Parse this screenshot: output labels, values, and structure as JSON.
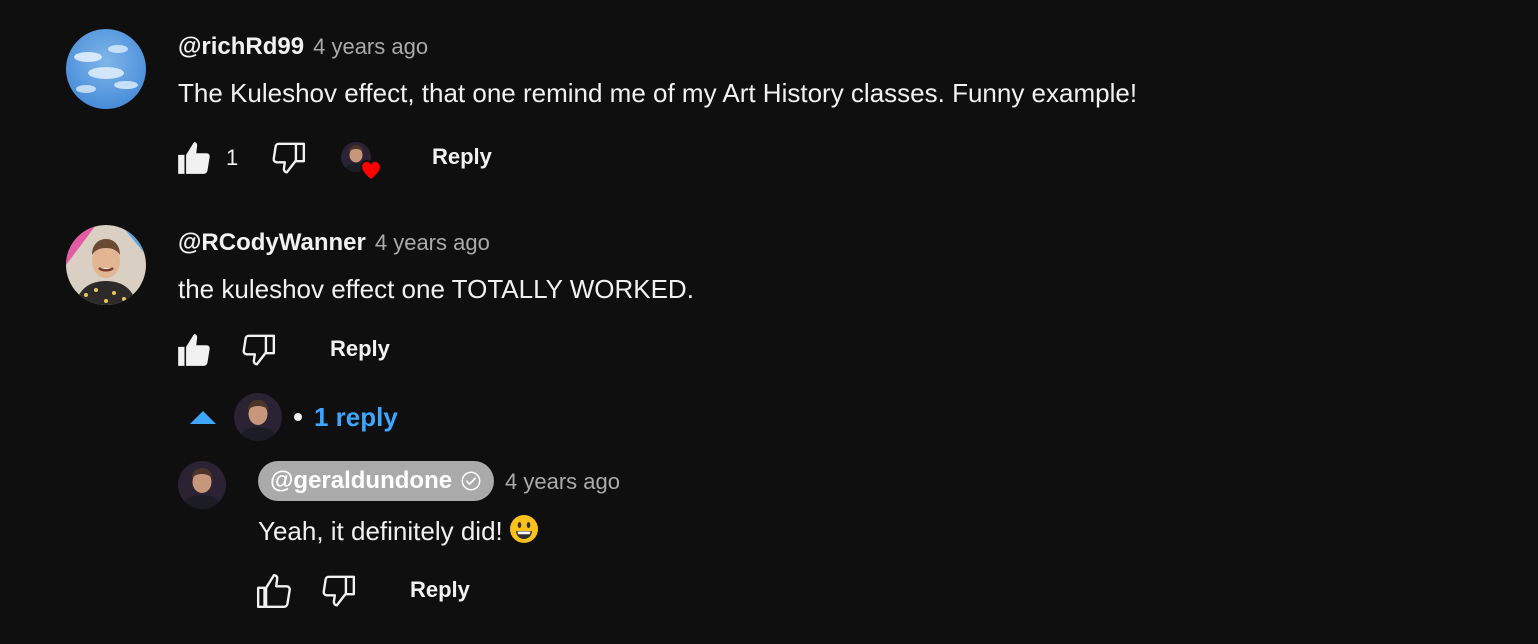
{
  "comments": [
    {
      "author": "@richRd99",
      "time": "4 years ago",
      "text": "The Kuleshov effect, that one remind me of my Art History classes. Funny example!",
      "likes": "1",
      "reply_label": "Reply",
      "hearted": true
    },
    {
      "author": "@RCodyWanner",
      "time": "4 years ago",
      "text": "the kuleshov effect one TOTALLY WORKED.",
      "likes": "",
      "reply_label": "Reply",
      "replies_toggle": "1 reply",
      "replies": [
        {
          "author": "@geraldundone",
          "time": "4 years ago",
          "text": "Yeah, it definitely did!",
          "emoji": "grinning-face",
          "reply_label": "Reply",
          "is_owner": true,
          "verified": true
        }
      ]
    }
  ],
  "colors": {
    "background": "#0f0f0f",
    "text": "#f1f1f1",
    "secondary_text": "#aaaaaa",
    "link_blue": "#3ea6ff",
    "heart_red": "#ff0000",
    "owner_chip": "#aaaaaa"
  },
  "icons": {
    "like": "thumbs-up-icon",
    "dislike": "thumbs-down-icon",
    "heart": "heart-icon",
    "collapse": "caret-up-icon",
    "verified": "check-circle-icon"
  }
}
